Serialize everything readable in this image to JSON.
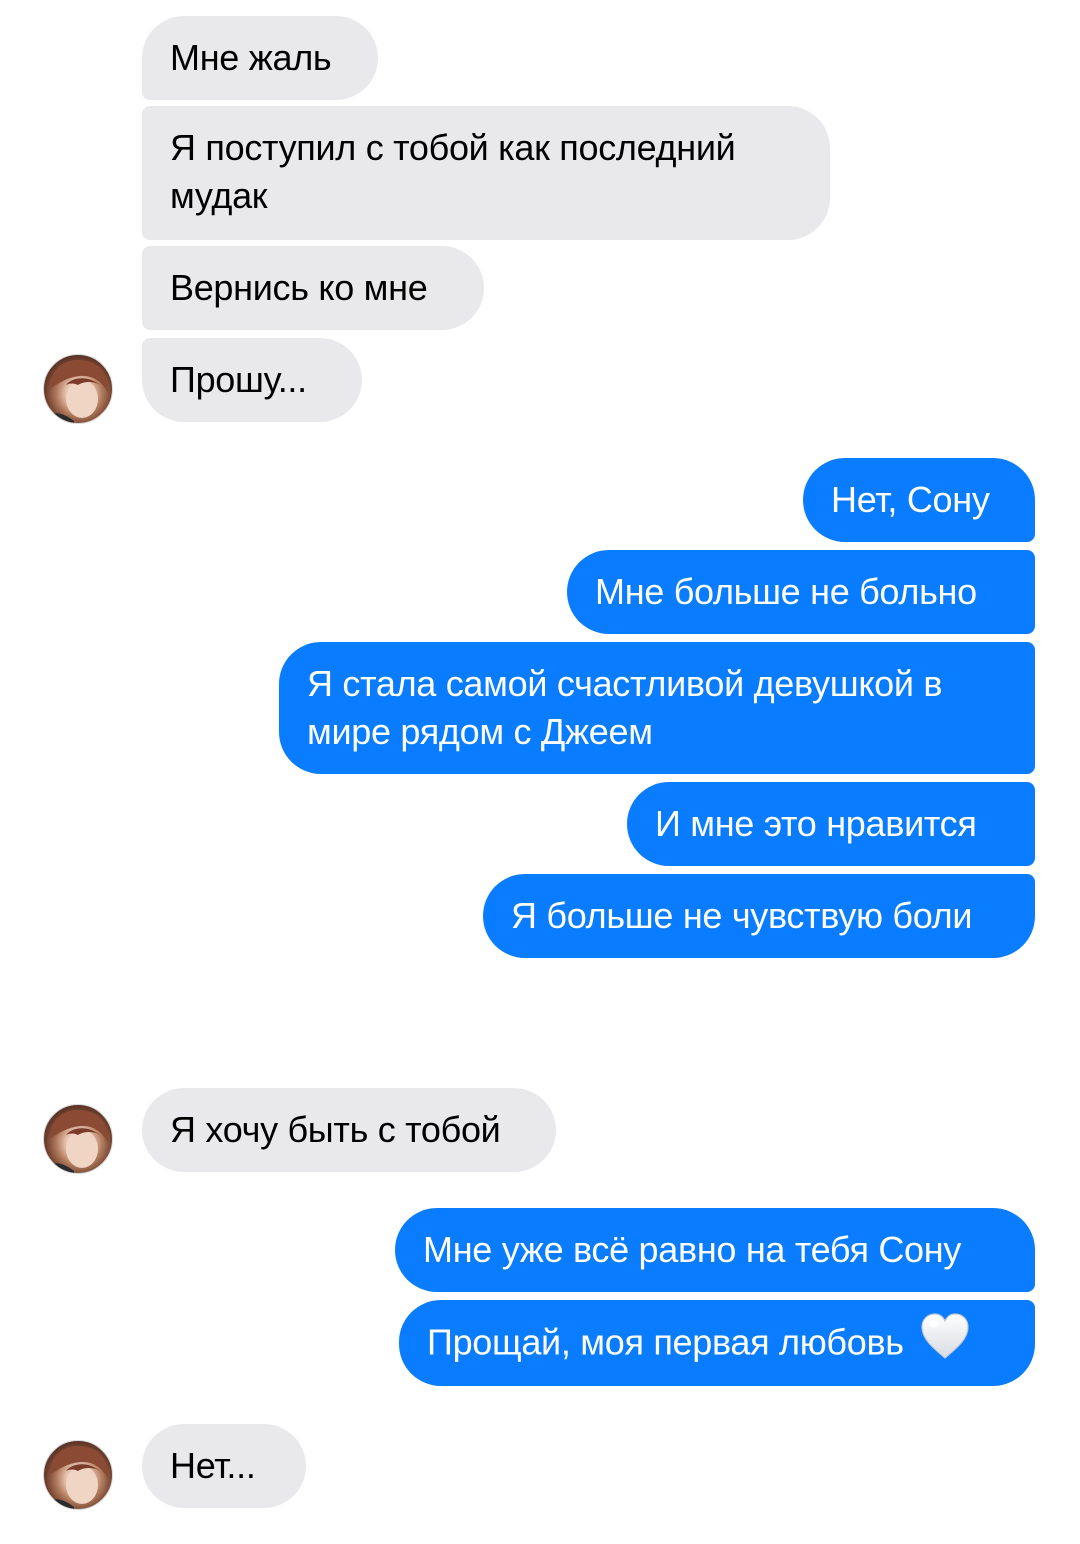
{
  "messages": [
    {
      "id": "in-1",
      "direction": "incoming",
      "text": "Мне жаль"
    },
    {
      "id": "in-2",
      "direction": "incoming",
      "text": "Я поступил с тобой как последний мудак"
    },
    {
      "id": "in-3",
      "direction": "incoming",
      "text": "Вернись ко мне"
    },
    {
      "id": "in-4",
      "direction": "incoming",
      "text": "Прошу..."
    },
    {
      "id": "out-1",
      "direction": "outgoing",
      "text": "Нет, Сону"
    },
    {
      "id": "out-2",
      "direction": "outgoing",
      "text": "Мне больше не больно"
    },
    {
      "id": "out-3",
      "direction": "outgoing",
      "text": "Я стала самой счастливой девушкой в мире рядом с Джеем"
    },
    {
      "id": "out-4",
      "direction": "outgoing",
      "text": "И мне это нравится"
    },
    {
      "id": "out-5",
      "direction": "outgoing",
      "text": "Я больше не чувствую боли"
    },
    {
      "id": "in-5",
      "direction": "incoming",
      "text": "Я хочу быть с тобой"
    },
    {
      "id": "out-6",
      "direction": "outgoing",
      "text": "Мне уже всё равно на тебя Сону"
    },
    {
      "id": "out-7",
      "direction": "outgoing",
      "text": "Прощай, моя первая любовь",
      "emoji": "white-heart-icon"
    },
    {
      "id": "in-6",
      "direction": "incoming",
      "text": "Нет..."
    }
  ],
  "colors": {
    "incoming_bubble": "#e9e9eb",
    "outgoing_bubble": "#0a7cff",
    "incoming_text": "#000000",
    "outgoing_text": "#ffffff"
  },
  "icons": {
    "avatar": "contact-avatar",
    "emoji": "white-heart-icon"
  }
}
